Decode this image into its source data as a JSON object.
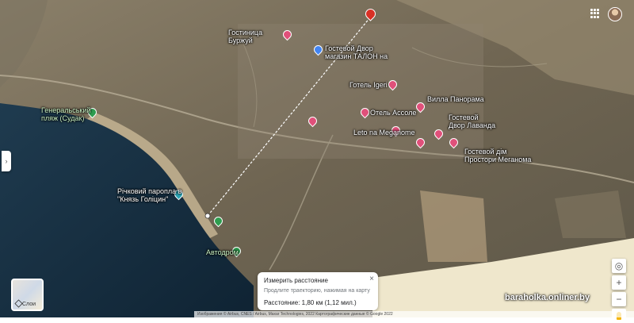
{
  "map": {
    "labels": {
      "generalsky_beach": "Генеральський\nпляж (Судак)",
      "hotel_burzhuy": "Гостиница\nБуржуй",
      "guest_talon": "Гостевой Двор\nмагазин ТАЛОН на",
      "hotel_igeri": "Готель Igeri",
      "villa_panorama": "Вилла Панорама",
      "hotel_assole": "Отель Ассоле",
      "guest_lavanda": "Гостевой\nДвор Лаванда",
      "leto_meganome": "Leto na Meganome",
      "guest_prostory": "Гостевой дім\nПростори Меганома",
      "ferry_golitsyn": "Річковий паропла в\n\"Князь Голіцин\"",
      "avtodrom": "Автодром"
    }
  },
  "measure": {
    "title": "Измерить расстояние",
    "hint": "Продлите траекторию, нажимая на карту",
    "distance": "Расстояние: 1,80 км (1,12 мил.)",
    "close": "×"
  },
  "layers": {
    "label": "Слои"
  },
  "controls": {
    "zoom_in": "+",
    "zoom_out": "−",
    "locate": "◎"
  },
  "watermark": "baraholka.onliner.by",
  "attribution": "Изображения © Airbus, CNES / Airbus, Maxar Technologies, 2022 Картографические данные © Google 2022",
  "side_toggle": "›"
}
